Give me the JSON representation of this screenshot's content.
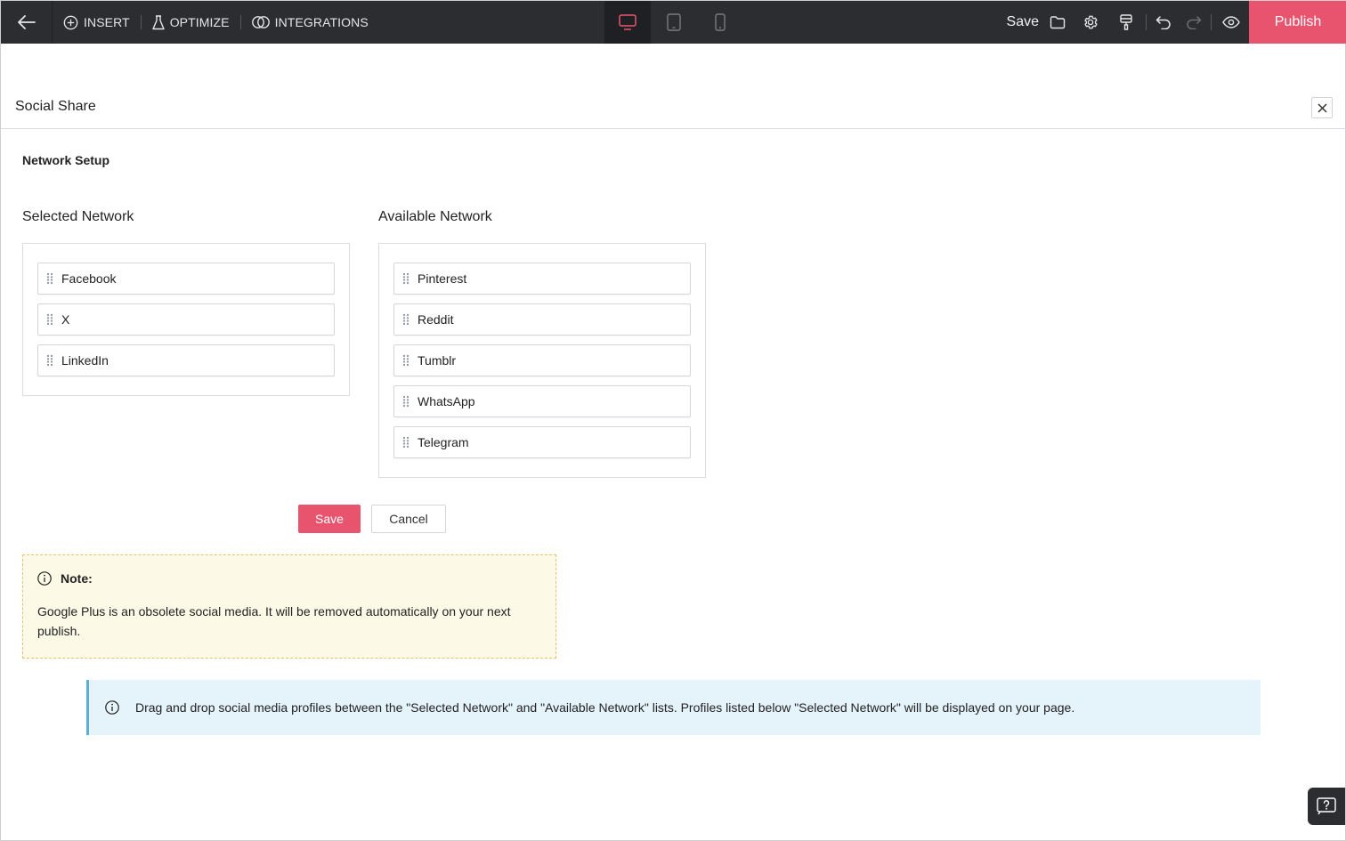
{
  "toolbar": {
    "insert_label": "INSERT",
    "optimize_label": "OPTIMIZE",
    "integrations_label": "INTEGRATIONS",
    "save_label": "Save",
    "publish_label": "Publish",
    "active_device": "desktop",
    "accent_color": "#e8546e"
  },
  "panel": {
    "title": "Social Share",
    "section_title": "Network Setup"
  },
  "selected": {
    "heading": "Selected Network",
    "items": [
      "Facebook",
      "X",
      "LinkedIn"
    ]
  },
  "available": {
    "heading": "Available Network",
    "items": [
      "Pinterest",
      "Reddit",
      "Tumblr",
      "WhatsApp",
      "Telegram"
    ]
  },
  "actions": {
    "save_label": "Save",
    "cancel_label": "Cancel"
  },
  "note": {
    "title": "Note:",
    "text": "Google Plus is an obsolete social media. It will be removed automatically on your next publish."
  },
  "info": {
    "text": "Drag and drop social media profiles between the \"Selected Network\" and \"Available Network\" lists. Profiles listed below \"Selected Network\" will be displayed on your page."
  }
}
